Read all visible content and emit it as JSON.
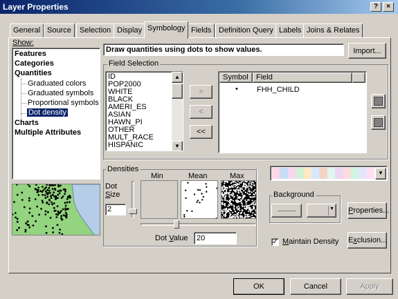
{
  "window": {
    "title": "Layer Properties",
    "help_label": "?",
    "close_label": "×"
  },
  "tabs": [
    {
      "label": "General"
    },
    {
      "label": "Source"
    },
    {
      "label": "Selection"
    },
    {
      "label": "Display"
    },
    {
      "label": "Symbology"
    },
    {
      "label": "Fields"
    },
    {
      "label": "Definition Query"
    },
    {
      "label": "Labels"
    },
    {
      "label": "Joins & Relates"
    }
  ],
  "show": {
    "label": "Show:",
    "items": [
      {
        "label": "Features"
      },
      {
        "label": "Categories"
      },
      {
        "label": "Quantities"
      },
      {
        "label": "Graduated colors"
      },
      {
        "label": "Graduated symbols"
      },
      {
        "label": "Proportional symbols"
      },
      {
        "label": "Dot density"
      },
      {
        "label": "Charts"
      },
      {
        "label": "Multiple Attributes"
      }
    ],
    "selected": "Dot density"
  },
  "header": {
    "description": "Draw quantities using dots to show values.",
    "import_label": "Import..."
  },
  "field_selection": {
    "label": "Field Selection",
    "fields": [
      "ID",
      "POP2000",
      "WHITE",
      "BLACK",
      "AMERI_ES",
      "ASIAN",
      "HAWN_PI",
      "OTHER",
      "MULT_RACE",
      "HISPANIC"
    ],
    "add_label": ">",
    "remove_label": "<",
    "remove_all_label": "<<",
    "symbol_header": "Symbol",
    "field_header": "Field",
    "selected_fields": [
      {
        "symbol": "•",
        "field": "FHH_CHILD"
      }
    ]
  },
  "densities": {
    "label": "Densities",
    "min_label": "Min",
    "mean_label": "Mean",
    "max_label": "Max",
    "dot_size_label": "Dot Size",
    "dot_size_value": "2",
    "dot_value_label": "Dot Value",
    "dot_value": "20",
    "slider_position": 0.3
  },
  "background": {
    "label": "Background"
  },
  "buttons": {
    "properties_label": "Properties...",
    "exclusion_label": "Exclusion...",
    "ok_label": "OK",
    "cancel_label": "Cancel",
    "apply_label": "Apply"
  },
  "maintain_density": {
    "label": "Maintain Density",
    "checked": true
  },
  "colors": {
    "ramp": [
      "#ffd6e6",
      "#c9dcf7",
      "#f7d7f0",
      "#d4f0d4",
      "#ffe9c4",
      "#d6e8ff",
      "#f5d3c5",
      "#dff5f0",
      "#eed6f5",
      "#ffdcdc",
      "#d0f5e0",
      "#e4e4ff",
      "#ffe0f0"
    ],
    "selection": "#0a246a",
    "map_land": "#94d37f",
    "map_water": "#b5cde6"
  }
}
